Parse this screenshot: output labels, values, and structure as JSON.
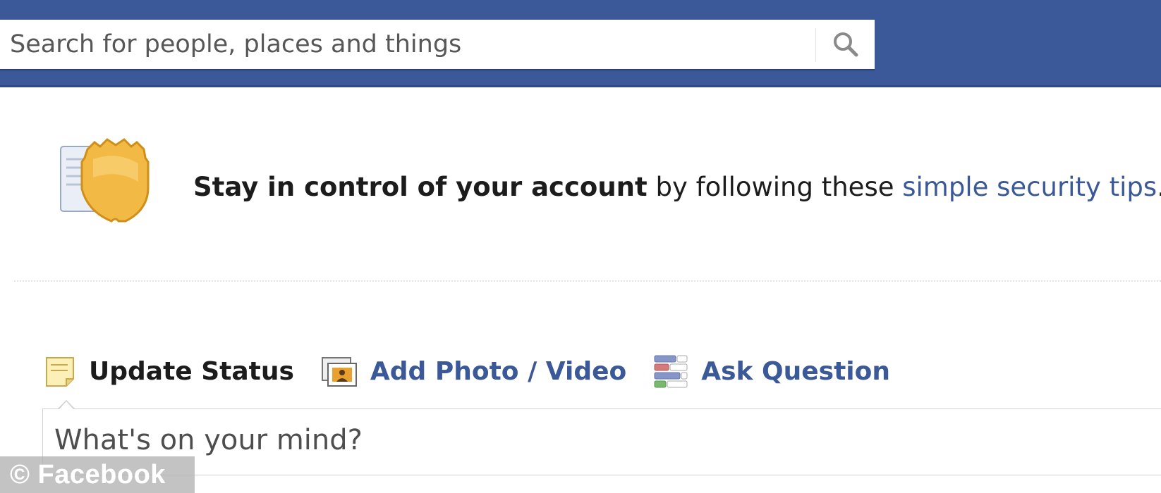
{
  "topbar": {
    "search": {
      "placeholder": "Search for people, places and things",
      "icon": "magnifier"
    }
  },
  "notice": {
    "icon": "security-shield",
    "bold_text": "Stay in control of your account",
    "plain_text": " by following these ",
    "link_text": "simple security tips",
    "trailing": "."
  },
  "composer": {
    "tabs": [
      {
        "label": "Update Status",
        "icon": "note-icon",
        "active": true
      },
      {
        "label": "Add Photo / Video",
        "icon": "photo-icon",
        "active": false
      },
      {
        "label": "Ask Question",
        "icon": "question-poll-icon",
        "active": false
      }
    ],
    "placeholder": "What's on your mind?"
  },
  "watermark": {
    "text": "© Facebook"
  },
  "colors": {
    "brand": "#3b5998",
    "text": "#1c1c1c",
    "shield": "#f2b945"
  }
}
